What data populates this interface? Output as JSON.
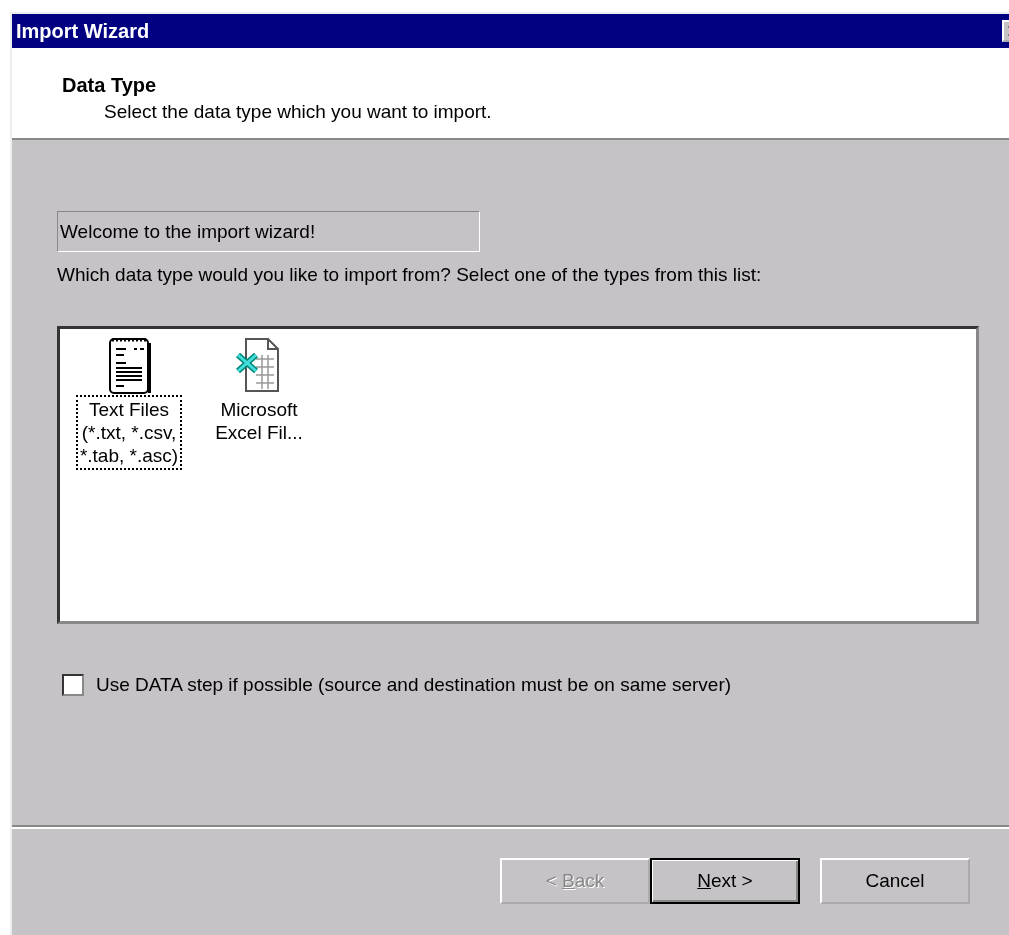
{
  "window": {
    "title": "Import Wizard"
  },
  "header": {
    "title": "Data Type",
    "subtitle": "Select the data type which you want to import."
  },
  "message_field": {
    "value": "Welcome to the import wizard!"
  },
  "prompt": "Which data type would you like to import from?  Select one of the types from this list:",
  "types": [
    {
      "kind": "text",
      "lines": [
        "Text Files",
        "(*.txt, *.csv,",
        "*.tab, *.asc)"
      ],
      "selected": true
    },
    {
      "kind": "excel",
      "lines": [
        "Microsoft",
        "Excel Fil..."
      ],
      "selected": false
    }
  ],
  "data_step": {
    "label": "Use DATA step if possible (source and destination must be on same server)",
    "checked": false
  },
  "buttons": [
    {
      "before": "< ",
      "key": "B",
      "after": "ack",
      "disabled": true,
      "default": false
    },
    {
      "key": "N",
      "after": "ext >",
      "disabled": false,
      "default": true
    },
    {
      "before": "Cancel",
      "disabled": false,
      "default": false
    }
  ]
}
